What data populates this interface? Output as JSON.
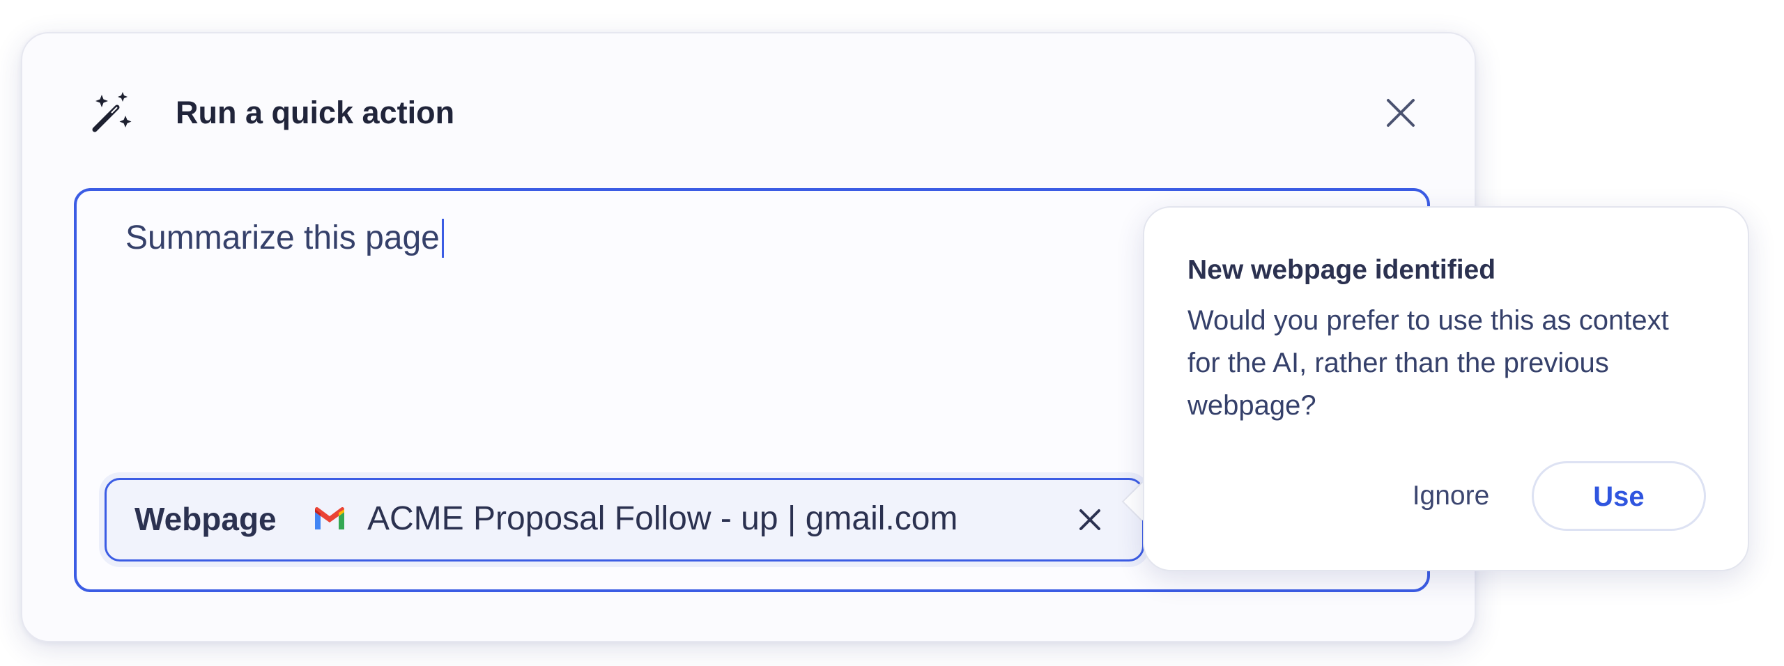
{
  "dialog": {
    "title": "Run a quick action",
    "header_icon": "magic-wand-sparkles-icon",
    "close_icon": "close-icon"
  },
  "input": {
    "value": "Summarize this page"
  },
  "context_chip": {
    "type_label": "Webpage",
    "source_icon": "gmail-icon",
    "title": "ACME Proposal Follow - up | gmail.com",
    "remove_icon": "close-icon"
  },
  "popover": {
    "title": "New webpage identified",
    "body": "Would you prefer to use this as context for the AI, rather than the previous webpage?",
    "ignore_label": "Ignore",
    "use_label": "Use"
  },
  "colors": {
    "accent": "#3b5ce4",
    "title_text": "#20243a",
    "body_text": "#35406a",
    "dialog_bg": "#fbfbfe",
    "chip_bg": "#f1f3fc",
    "gmail_red": "#ea4335",
    "gmail_blue": "#4285f4",
    "gmail_green": "#34a853",
    "gmail_yellow": "#fbbc05"
  }
}
